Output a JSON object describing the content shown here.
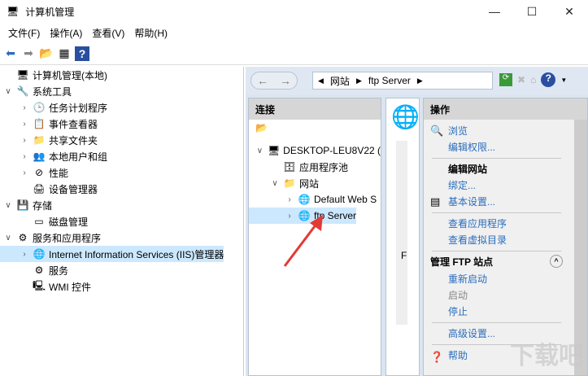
{
  "window": {
    "title": "计算机管理",
    "min": "—",
    "max": "☐",
    "close": "✕"
  },
  "menu": [
    "文件(F)",
    "操作(A)",
    "查看(V)",
    "帮助(H)"
  ],
  "tree": [
    {
      "label": "计算机管理(本地)",
      "level": 0,
      "chev": "",
      "icon": "🖥"
    },
    {
      "label": "系统工具",
      "level": 0,
      "chev": "∨",
      "icon": "🔧"
    },
    {
      "label": "任务计划程序",
      "level": 1,
      "chev": "›",
      "icon": "🕒"
    },
    {
      "label": "事件查看器",
      "level": 1,
      "chev": "›",
      "icon": "📋"
    },
    {
      "label": "共享文件夹",
      "level": 1,
      "chev": "›",
      "icon": "📁"
    },
    {
      "label": "本地用户和组",
      "level": 1,
      "chev": "›",
      "icon": "👥"
    },
    {
      "label": "性能",
      "level": 1,
      "chev": "›",
      "icon": "⊘"
    },
    {
      "label": "设备管理器",
      "level": 1,
      "chev": "",
      "icon": "🖨"
    },
    {
      "label": "存储",
      "level": 0,
      "chev": "∨",
      "icon": "💾"
    },
    {
      "label": "磁盘管理",
      "level": 1,
      "chev": "",
      "icon": "▭"
    },
    {
      "label": "服务和应用程序",
      "level": 0,
      "chev": "∨",
      "icon": "⚙"
    },
    {
      "label": "Internet Information Services (IIS)管理器",
      "level": 1,
      "chev": "›",
      "icon": "🌐",
      "selected": true
    },
    {
      "label": "服务",
      "level": 1,
      "chev": "",
      "icon": "⚙"
    },
    {
      "label": "WMI 控件",
      "level": 1,
      "chev": "",
      "icon": "🖳"
    }
  ],
  "iis": {
    "breadcrumb": [
      "网站",
      "ftp Server"
    ],
    "connections": {
      "title": "连接",
      "tree": [
        {
          "label": "DESKTOP-LEU8V22 (",
          "level": 0,
          "chev": "∨",
          "icon": "🖥"
        },
        {
          "label": "应用程序池",
          "level": 1,
          "chev": "",
          "icon": "🗄"
        },
        {
          "label": "网站",
          "level": 1,
          "chev": "∨",
          "icon": "📁"
        },
        {
          "label": "Default Web S",
          "level": 2,
          "chev": "›",
          "icon": "🌐"
        },
        {
          "label": "ftp Server",
          "level": 2,
          "chev": "›",
          "icon": "🌐",
          "selected": true
        }
      ]
    },
    "middle_text": "F",
    "actions": {
      "title": "操作",
      "browse": "浏览",
      "edit_perm": "编辑权限...",
      "edit_site": "编辑网站",
      "bindings": "绑定...",
      "basic": "基本设置...",
      "view_apps": "查看应用程序",
      "view_vdirs": "查看虚拟目录",
      "ftp_section": "管理 FTP 站点",
      "restart": "重新启动",
      "start": "启动",
      "stop": "停止",
      "advanced": "高级设置...",
      "help": "帮助"
    }
  },
  "colors": {
    "accent": "#2a6dbb",
    "selection": "#cce8ff",
    "arrow": "#e53935"
  }
}
